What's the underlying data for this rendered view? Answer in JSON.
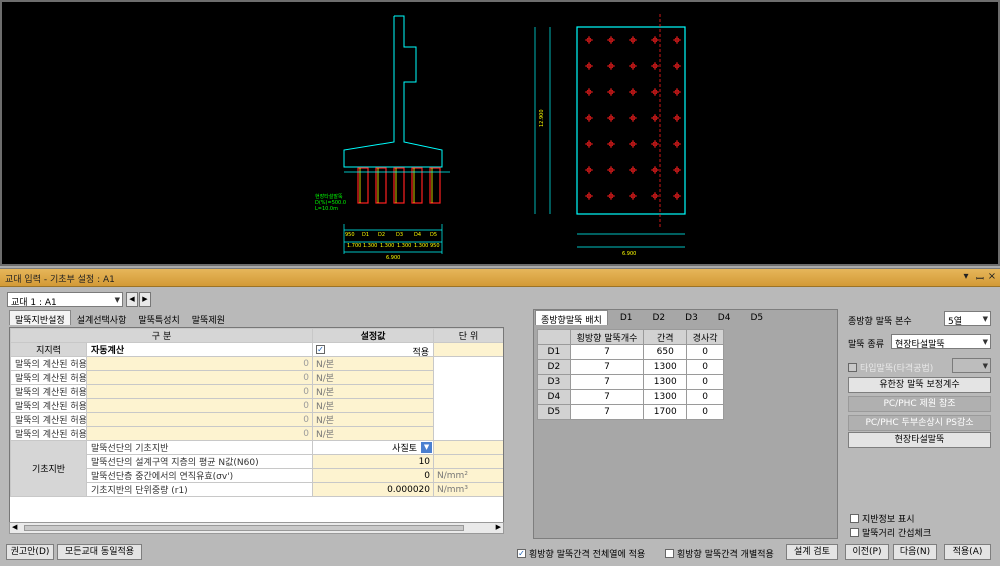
{
  "cad": {
    "left_labels": [
      "현장타설말뚝",
      "D(%)=500.0",
      "L=10.0m"
    ],
    "left_dims": [
      "950",
      "D1",
      "D2",
      "D3",
      "D4",
      "D5",
      "950"
    ],
    "left_dims_values": [
      "1.700",
      "1.300",
      "1.300",
      "1.300",
      "1.300",
      "950"
    ],
    "left_total": "6.900",
    "right_total": "6.900",
    "right_height": "12.900"
  },
  "window": {
    "title": "교대 입력 - 기초부 설정 : A1",
    "pin": "▾",
    "dock": "ꟷ",
    "close": "×"
  },
  "selector": {
    "value": "교대 1 : A1"
  },
  "tabs": [
    "말뚝지반설정",
    "설계선택사항",
    "말뚝특성치",
    "말뚝제원"
  ],
  "grid": {
    "headers": [
      "구 분",
      "설정값",
      "단 위"
    ],
    "auto_calc": {
      "label": "자동계산",
      "value": "적용"
    },
    "group1": "지지력",
    "rows1": [
      {
        "label": "말뚝의 계산된 허용지지력 : 사용한계상태",
        "value": "0",
        "unit": "N/본"
      },
      {
        "label": "말뚝의 계산된 허용지지력 : 극한한계상태",
        "value": "0",
        "unit": "N/본"
      },
      {
        "label": "말뚝의 계산된 허용지지력 : 극단상황한계상태",
        "value": "0",
        "unit": "N/본"
      },
      {
        "label": "말뚝의 계산된 허용인발력 : 사용한계상태",
        "value": "0",
        "unit": "N/본"
      },
      {
        "label": "말뚝의 계산된 허용인발력 : 극한한계상태",
        "value": "0",
        "unit": "N/본"
      },
      {
        "label": "말뚝의 계산된 허용인발력 : 극단상황한계상태",
        "value": "0",
        "unit": "N/본"
      }
    ],
    "group2": "기초지반",
    "rows2": [
      {
        "label": "말뚝선단의 기초지반",
        "value": "사질토",
        "unit": ""
      },
      {
        "label": "말뚝선단의 설계구역 지층의 평균 N값(N60)",
        "value": "10",
        "unit": ""
      },
      {
        "label": "말뚝선단층 중간에서의 연직유효(σv')",
        "value": "0",
        "unit": "N/mm²"
      },
      {
        "label": "기초지반의 단위중량 (r1)",
        "value": "0.000020",
        "unit": "N/mm³"
      }
    ]
  },
  "mid": {
    "tabs": [
      "종방향말뚝 배치",
      "D1",
      "D2",
      "D3",
      "D4",
      "D5"
    ],
    "headers": [
      "횡방향 말뚝개수",
      "간격",
      "경사각"
    ],
    "rows": [
      {
        "name": "D1",
        "count": "7",
        "gap": "650",
        "angle": "0"
      },
      {
        "name": "D2",
        "count": "7",
        "gap": "1300",
        "angle": "0"
      },
      {
        "name": "D3",
        "count": "7",
        "gap": "1300",
        "angle": "0"
      },
      {
        "name": "D4",
        "count": "7",
        "gap": "1300",
        "angle": "0"
      },
      {
        "name": "D5",
        "count": "7",
        "gap": "1700",
        "angle": "0"
      }
    ]
  },
  "right": {
    "count_label": "종방향 말뚝 본수",
    "count_value": "5열",
    "type_label": "말뚝 종류",
    "type_value": "현장타설말뚝",
    "tip_label": "타입말뚝(타격공법)",
    "btn1": "유한장 말뚝 보정계수",
    "btn2": "PC/PHC 제원 참조",
    "btn3": "PC/PHC 두부손상시 PS감소",
    "btn4": "현장타설말뚝",
    "chk1": "지반정보 표시",
    "chk2": "말뚝거리 간섭체크"
  },
  "footer": {
    "recommend": "권고안(D)",
    "apply_all": "모든교대 동일적용",
    "chk_all": "횡방향 말뚝간격 전체열에 적용",
    "chk_each": "횡방향 말뚝간격 개별적용",
    "review": "설계 검토",
    "prev": "이전(P)",
    "next": "다음(N)",
    "apply": "적용(A)"
  },
  "colors": {
    "cad_bg": "#000000",
    "cyan": "#00ffff",
    "red": "#ff2020",
    "yellow": "#ffff00",
    "green": "#00ff00"
  }
}
